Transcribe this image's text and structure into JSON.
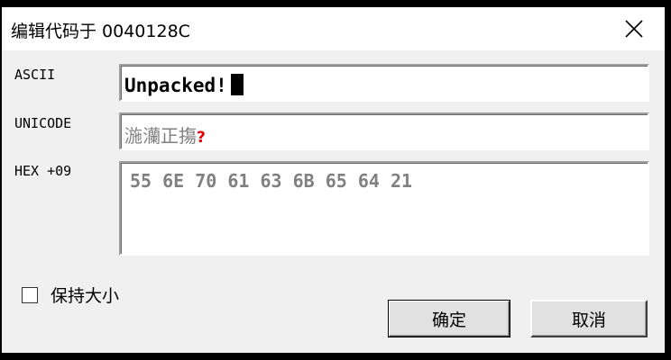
{
  "window": {
    "title": "编辑代码于 0040128C",
    "close_icon": "close-icon"
  },
  "fields": {
    "ascii": {
      "label": "ASCII",
      "value": "Unpacked!"
    },
    "unicode": {
      "label": "UNICODE",
      "value": "湤灡正摥",
      "invalid_char": "?"
    },
    "hex": {
      "label": "HEX +09",
      "value": "55 6E 70 61 63 6B 65 64 21"
    }
  },
  "options": {
    "keep_size": {
      "label": "保持大小",
      "checked": false
    }
  },
  "buttons": {
    "ok": "确定",
    "cancel": "取消"
  },
  "colors": {
    "background": "#f0f0f0",
    "titlebar": "#ffffff",
    "disabled_text": "#808080",
    "invalid_char": "#e00000"
  }
}
